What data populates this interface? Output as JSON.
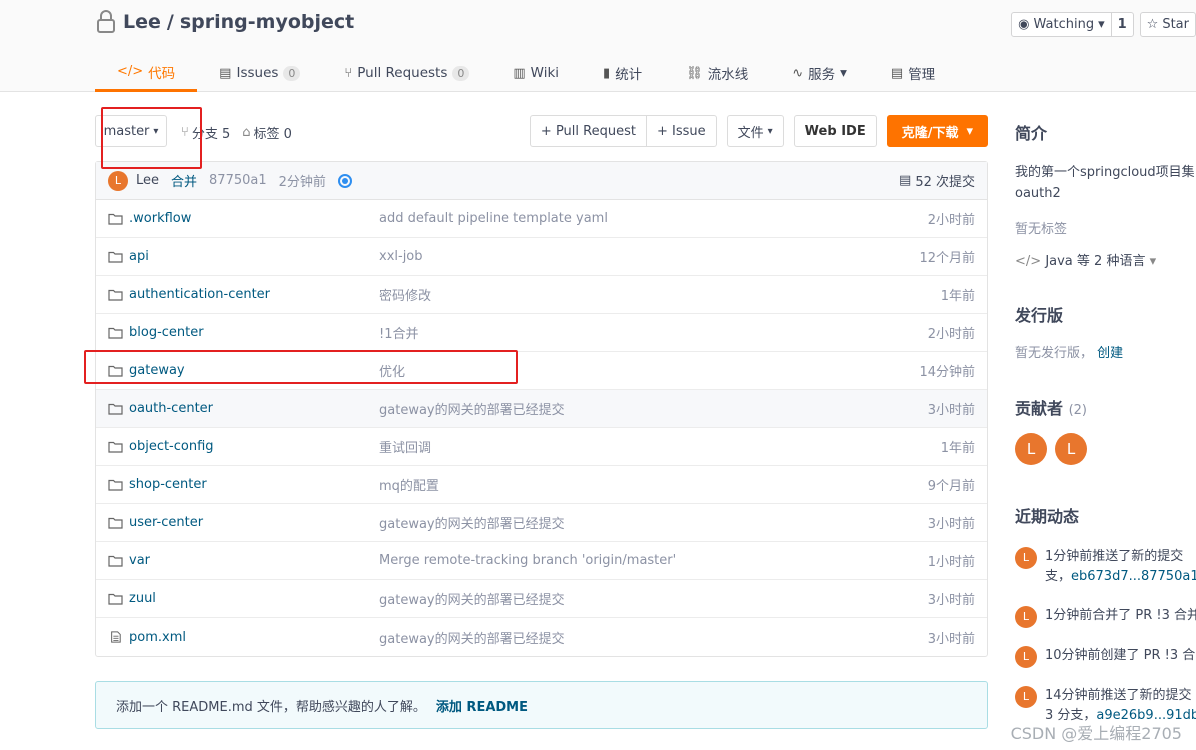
{
  "repo": {
    "owner": "Lee",
    "separator": "/",
    "name": "spring-myobject"
  },
  "header_actions": {
    "watch_label": "Watching",
    "watch_count": "1",
    "star_label": "Star"
  },
  "tabs": [
    {
      "icon": "</>",
      "label": "代码",
      "badge": ""
    },
    {
      "icon": "▤",
      "label": "Issues",
      "badge": "0"
    },
    {
      "icon": "⑂",
      "label": "Pull Requests",
      "badge": "0"
    },
    {
      "icon": "▥",
      "label": "Wiki",
      "badge": ""
    },
    {
      "icon": "▮",
      "label": "统计",
      "badge": ""
    },
    {
      "icon": "⛓",
      "label": "流水线",
      "badge": ""
    },
    {
      "icon": "∿",
      "label": "服务",
      "badge": ""
    },
    {
      "icon": "▤",
      "label": "管理",
      "badge": ""
    }
  ],
  "toolbar": {
    "branch": "master",
    "branches_label": "分支 5",
    "tags_label": "标签 0",
    "pull_request": "+ Pull Request",
    "issue": "+ Issue",
    "file": "文件",
    "web_ide": "Web IDE",
    "clone": "克隆/下载"
  },
  "last_commit": {
    "avatar": "L",
    "author": "Lee",
    "message": "合并",
    "sha": "87750a1",
    "time": "2分钟前",
    "count": "52 次提交"
  },
  "files": [
    {
      "type": "folder",
      "name": ".workflow",
      "message": "add default pipeline template yaml",
      "time": "2小时前"
    },
    {
      "type": "folder",
      "name": "api",
      "message": "xxl-job",
      "time": "12个月前"
    },
    {
      "type": "folder",
      "name": "authentication-center",
      "message": "密码修改",
      "time": "1年前"
    },
    {
      "type": "folder",
      "name": "blog-center",
      "message": "!1合并",
      "time": "2小时前"
    },
    {
      "type": "folder",
      "name": "gateway",
      "message": "优化",
      "time": "14分钟前"
    },
    {
      "type": "folder",
      "name": "oauth-center",
      "message": "gateway的网关的部署已经提交",
      "time": "3小时前"
    },
    {
      "type": "folder",
      "name": "object-config",
      "message": "重试回调",
      "time": "1年前"
    },
    {
      "type": "folder",
      "name": "shop-center",
      "message": "mq的配置",
      "time": "9个月前"
    },
    {
      "type": "folder",
      "name": "user-center",
      "message": "gateway的网关的部署已经提交",
      "time": "3小时前"
    },
    {
      "type": "folder",
      "name": "var",
      "message": "Merge remote-tracking branch 'origin/master'",
      "time": "1小时前"
    },
    {
      "type": "folder",
      "name": "zuul",
      "message": "gateway的网关的部署已经提交",
      "time": "3小时前"
    },
    {
      "type": "file",
      "name": "pom.xml",
      "message": "gateway的网关的部署已经提交",
      "time": "3小时前"
    }
  ],
  "readme": {
    "text": "添加一个 README.md 文件，帮助感兴趣的人了解。",
    "link": "添加 README"
  },
  "sidebar": {
    "intro_title": "简介",
    "intro_line1": "我的第一个springcloud项目集",
    "intro_line2": "oauth2",
    "no_tags": "暂无标签",
    "languages": "Java 等 2 种语言",
    "release_title": "发行版",
    "no_release": "暂无发行版，",
    "create": "创建",
    "contributors_title": "贡献者",
    "contributors_count": "(2)",
    "contributors": [
      "L",
      "L"
    ],
    "activity_title": "近期动态",
    "activities": [
      {
        "avatar": "L",
        "line1": "1分钟前推送了新的提交",
        "line2_pre": "支，",
        "line2_link": "eb673d7...87750a1"
      },
      {
        "avatar": "L",
        "line1": "1分钟前合并了 PR !3 合并",
        "line2_pre": "",
        "line2_link": ""
      },
      {
        "avatar": "L",
        "line1": "10分钟前创建了 PR !3 合",
        "line2_pre": "",
        "line2_link": ""
      },
      {
        "avatar": "L",
        "line1": "14分钟前推送了新的提交",
        "line2_pre": "3 分支，",
        "line2_link": "a9e26b9...91db"
      }
    ]
  },
  "watermark": "CSDN @爱上编程2705",
  "colors": {
    "accent": "#fe7300",
    "link": "#005980",
    "avatar": "#e8762d",
    "highlight_box": "#e32020"
  }
}
